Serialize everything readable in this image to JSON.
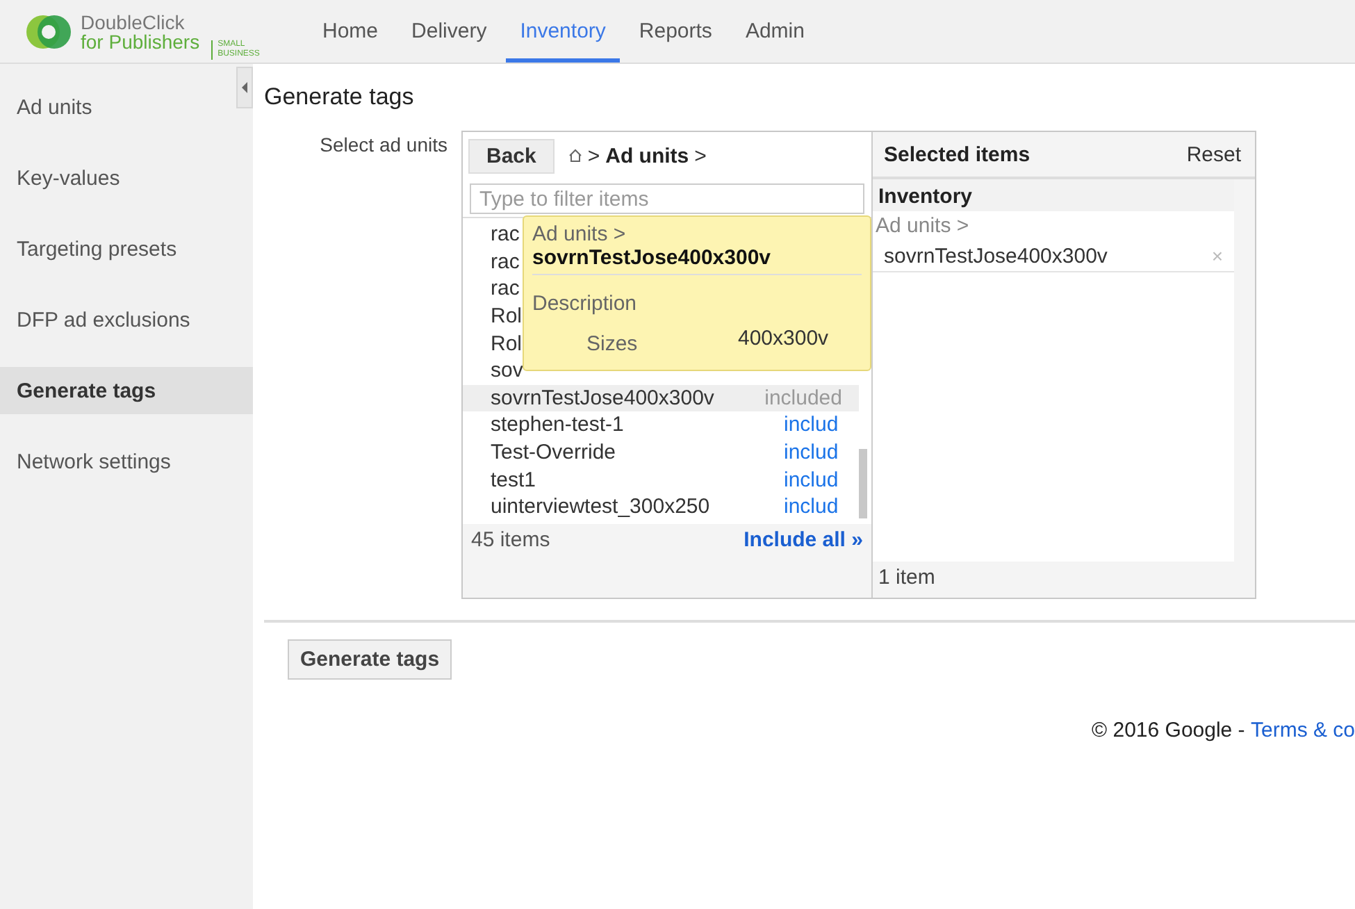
{
  "logo": {
    "line1": "DoubleClick",
    "line2": "for Publishers",
    "edition": "SMALL BUSINESS"
  },
  "nav": [
    {
      "label": "Home",
      "selected": false
    },
    {
      "label": "Delivery",
      "selected": false
    },
    {
      "label": "Inventory",
      "selected": true
    },
    {
      "label": "Reports",
      "selected": false
    },
    {
      "label": "Admin",
      "selected": false
    }
  ],
  "sidebar": {
    "items": [
      {
        "label": "Ad units",
        "selected": false
      },
      {
        "label": "Key-values",
        "selected": false
      },
      {
        "label": "Targeting presets",
        "selected": false
      },
      {
        "label": "DFP ad exclusions",
        "selected": false
      },
      {
        "label": "Generate tags",
        "selected": true
      },
      {
        "label": "Network settings",
        "selected": false
      }
    ]
  },
  "page_title": "Generate tags",
  "field_label": "Select ad units",
  "picker": {
    "back": "Back",
    "breadcrumb_sep1": ">",
    "breadcrumb": "Ad units",
    "breadcrumb_sep2": ">",
    "filter_placeholder": "Type to filter items",
    "items": [
      {
        "name": "rac",
        "selected": false
      },
      {
        "name": "rac",
        "selected": false
      },
      {
        "name": "rac",
        "selected": false
      },
      {
        "name": "Rol",
        "selected": false
      },
      {
        "name": "Rol",
        "selected": false
      },
      {
        "name": "sov",
        "selected": false
      },
      {
        "name": "sovrnTestJose400x300v",
        "status": "included",
        "selected": true
      },
      {
        "name": "stephen-test-1",
        "status": "includ",
        "selected": false
      },
      {
        "name": "Test-Override",
        "status": "includ",
        "selected": false
      },
      {
        "name": "test1",
        "status": "includ",
        "selected": false
      },
      {
        "name": "uinterviewtest_300x250",
        "status": "includ",
        "selected": false
      }
    ],
    "count": "45 items",
    "include_all": "Include all »",
    "tooltip": {
      "path": "Ad units >",
      "name": "sovrnTestJose400x300v",
      "description_label": "Description",
      "sizes_label": "Sizes",
      "sizes": "400x300v"
    }
  },
  "selected": {
    "title": "Selected items",
    "reset": "Reset",
    "group": "Inventory",
    "path": "Ad units >",
    "items": [
      {
        "name": "sovrnTestJose400x300v",
        "remove": "×"
      }
    ],
    "count": "1 item"
  },
  "generate_button": "Generate tags",
  "footer": {
    "copyright": "© 2016 Google - ",
    "link": "Terms & co"
  }
}
